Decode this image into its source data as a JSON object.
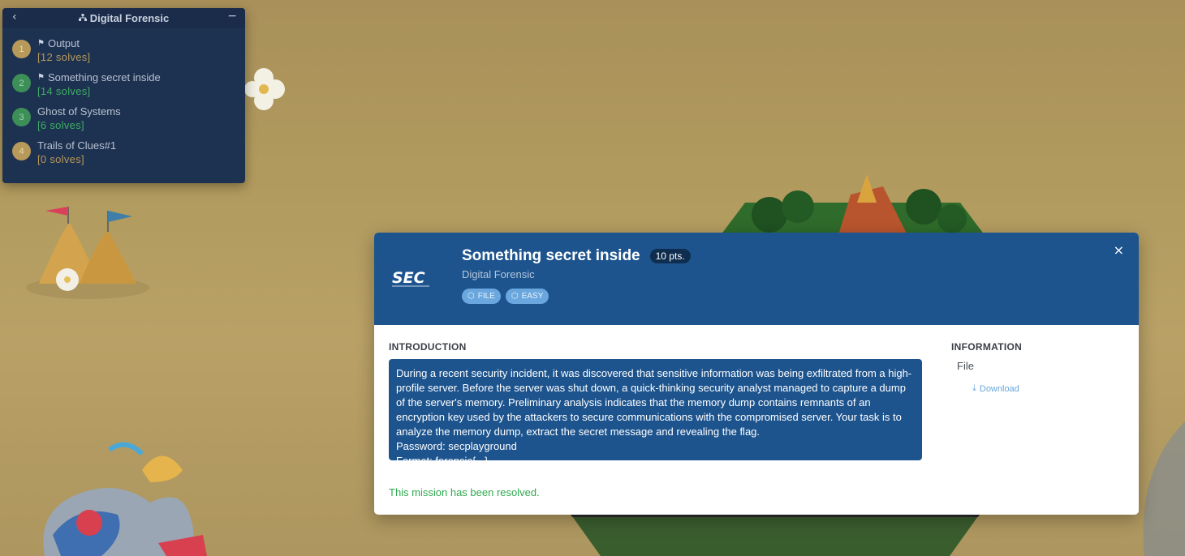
{
  "sidebar": {
    "title": "Digital Forensic",
    "back_icon": "‹",
    "minimize_icon": "−",
    "items": [
      {
        "num": "1",
        "name": "Output",
        "solves": "[12 solves]",
        "flagged": true,
        "color": "#b7995a"
      },
      {
        "num": "2",
        "name": "Something secret inside",
        "solves": "[14 solves]",
        "flagged": true,
        "color": "#3d8f58"
      },
      {
        "num": "3",
        "name": "Ghost of Systems",
        "solves": "[6 solves]",
        "flagged": false,
        "color": "#3d8f58"
      },
      {
        "num": "4",
        "name": "Trails of Clues#1",
        "solves": "[0 solves]",
        "flagged": false,
        "color": "#b7995a"
      }
    ]
  },
  "modal": {
    "title": "Something secret inside",
    "points": "10 pts.",
    "category": "Digital Forensic",
    "tags": [
      "FILE",
      "EASY"
    ],
    "close_icon": "×",
    "intro_heading": "INTRODUCTION",
    "info_heading": "INFORMATION",
    "description": [
      "During a recent security incident, it was discovered that sensitive information was being exfiltrated from a high-profile server. Before the server was shut down, a quick-thinking security analyst managed to capture a dump of the server's memory. Preliminary analysis indicates that the memory dump contains remnants of an encryption key used by the attackers to secure communications with the compromised server. Your task is to analyze the memory dump, extract the secret message and revealing the flag.",
      "Password: secplayground",
      "Format: forensic{...}"
    ],
    "status": "This mission has been resolved.",
    "info_type": "File",
    "download_label": "Download"
  },
  "logo_text": "SEC",
  "colors": {
    "header_blue": "#1d548e",
    "success_green": "#2fa84f",
    "panel_bg": "#1d3151"
  }
}
